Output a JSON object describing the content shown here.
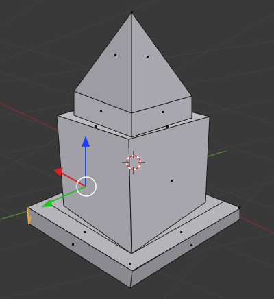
{
  "viewport": {
    "background": "#393939",
    "grid_color": "#424242",
    "x_axis_color": "#8a2e2e",
    "y_axis_color": "#5a8a2e"
  },
  "object": {
    "face_light": "#a9a9ae",
    "face_mid": "#9a9aa0",
    "face_dark": "#7f7f86",
    "edge_color": "#1a1a1a",
    "vertex_color": "#111111",
    "selected_edge_color": "#f0a030"
  },
  "manipulator": {
    "x_axis_color": "#e02020",
    "y_axis_color": "#20c020",
    "z_axis_color": "#2040ff",
    "center_ring_color": "#ffffff",
    "icons": [
      "arrow-x-icon",
      "arrow-y-icon",
      "arrow-z-icon",
      "center-ring-icon"
    ]
  },
  "cursor": {
    "icon": "3d-cursor-icon",
    "ring_red": "#e03030",
    "ring_white": "#ffffff"
  }
}
